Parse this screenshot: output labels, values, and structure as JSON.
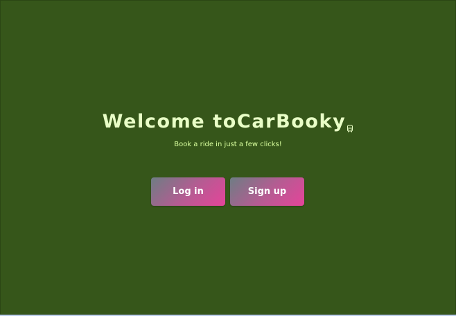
{
  "welcome": {
    "title_prefix": "Welcome to",
    "app_name": "CarBooky",
    "title_icon": "car-icon",
    "subtitle": "Book a ride in just a few clicks!"
  },
  "actions": {
    "login_label": "Log in",
    "signup_label": "Sign up"
  },
  "colors": {
    "background": "#36561a",
    "title_text": "#e9ffc7",
    "subtitle_text": "#d9ff9e",
    "button_gradient_start": "#6e7d84",
    "button_gradient_end": "#e5449a",
    "button_text": "#ffffff"
  }
}
